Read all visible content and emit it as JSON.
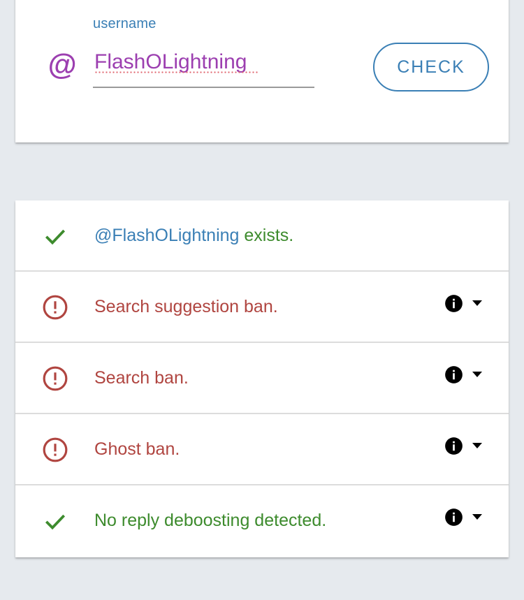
{
  "search": {
    "label": "username",
    "at_symbol": "@",
    "value": "FlashOLightning",
    "button_label": "CHECK"
  },
  "colors": {
    "accent_blue": "#3a7fb5",
    "username_purple": "#9c3fb0",
    "success_green": "#3d8b2d",
    "error_red": "#b04540"
  },
  "results": [
    {
      "status": "ok",
      "handle": "@FlashOLightning",
      "text": " exists."
    },
    {
      "status": "ban",
      "text": "Search suggestion ban.",
      "info_icon": "info-icon",
      "dropdown_icon": "chevron-down-icon"
    },
    {
      "status": "ban",
      "text": "Search ban.",
      "info_icon": "info-icon",
      "dropdown_icon": "chevron-down-icon"
    },
    {
      "status": "ban",
      "text": "Ghost ban.",
      "info_icon": "info-icon",
      "dropdown_icon": "chevron-down-icon"
    },
    {
      "status": "ok",
      "text": "No reply deboosting detected.",
      "info_icon": "info-icon",
      "dropdown_icon": "chevron-down-icon"
    }
  ]
}
